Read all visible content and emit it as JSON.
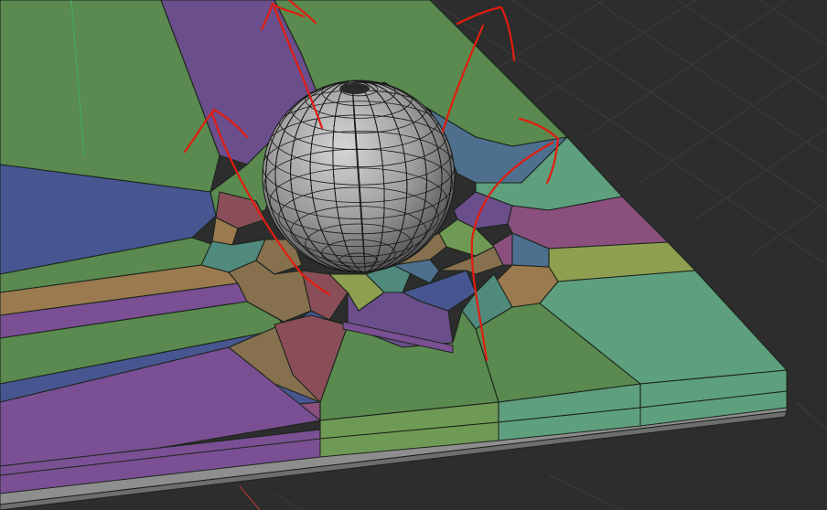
{
  "viewport": {
    "background_color": "#2d2d2d",
    "grid_color": "#3c3c3c",
    "axis_green_color": "#3fae6a",
    "axis_red_color": "#c0392b"
  },
  "ground_plane": {
    "base_color": "#8e8e8e",
    "base_side_color": "#6e6e6e",
    "fragment_colors": {
      "green": "#5a8a4f",
      "light_green": "#6f9a55",
      "olive": "#8ea050",
      "teal": "#4f8a7c",
      "sea_green": "#5e9f7e",
      "blue": "#475690",
      "steel_blue": "#4e6f8e",
      "purple": "#6b4e8c",
      "violet": "#7a4f94",
      "magenta": "#8a4f7c",
      "brown": "#86704e",
      "tan": "#9a7a4e",
      "rose": "#8a4e58",
      "gray_green": "#6d8a62"
    }
  },
  "sphere": {
    "fill_color": "#9c9c9c",
    "wire_color": "#1a1a1a"
  },
  "annotation": {
    "stroke_color": "#e11d0f"
  }
}
